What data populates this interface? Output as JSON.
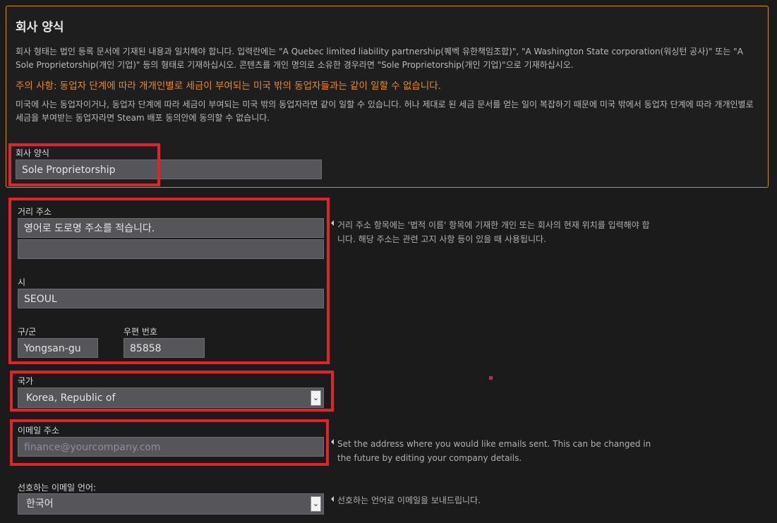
{
  "section": {
    "title": "회사 양식",
    "description_1": "회사 형태는 법인 등록 문서에 기재된 내용과 일치해야 합니다. 입력란에는 \"A Quebec limited liability partnership(퀘벡 유한책임조합)\", \"A Washington State corporation(워싱턴 공사)\" 또는 \"A Sole Proprietorship(개인 기업)\" 등의 형태로 기재하십시오. 콘텐츠를 개인 명의로 소유한 경우라면 \"Sole Proprietorship(개인 기업)\"으로 기재하십시오.",
    "warning": "주의 사항: 동업자 단계에 따라 개개인별로 세금이 부여되는 미국 밖의 동업자들과는 같이 일할 수 없습니다.",
    "description_2": "미국에 사는 동업자이거나, 동업자 단계에 따라 세금이 부여되는 미국 밖의 동업자라면 같이 일할 수 있습니다. 허나 제대로 된 세금 문서를 얻는 일이 복잡하기 때문에 미국 밖에서 동업자 단계에 따라 개개인별로 세금을 부여받는 동업자라면 Steam 배포 동의안에 동의할 수 없습니다.",
    "company_form_label": "회사 양식",
    "company_form_value": "Sole Proprietorship"
  },
  "address": {
    "street_label": "거리 주소",
    "street_line1": "영어로 도로명 주소를 적습니다.",
    "street_line2": "",
    "city_label": "시",
    "city_value": "SEOUL",
    "district_label": "구/군",
    "district_value": "Yongsan-gu",
    "postal_label": "우편 번호",
    "postal_value": "85858",
    "hint": "거리 주소 항목에는 '법적 이름' 항목에 기재한 개인 또는 회사의 현재 위치를 입력해야 합니다. 해당 주소는 관련 고지 사항 등이 있을 때 사용됩니다."
  },
  "country": {
    "label": "국가",
    "selected": "Korea, Republic of"
  },
  "email": {
    "label": "이메일 주소",
    "placeholder": "finance@yourcompany.com",
    "hint": "Set the address where you would like emails sent. This can be changed in the future by editing your company details."
  },
  "language": {
    "label": "선호하는 이메일 언어:",
    "selected": "한국어",
    "hint": "선호하는 언어로 이메일을 보내드립니다."
  },
  "colors": {
    "accent_border": "#c8912e",
    "warning_text": "#e8892b",
    "highlight_red": "#e3222b"
  },
  "icons": {
    "dropdown": "chevron-down-icon",
    "hint_pointer": "triangle-left-icon"
  }
}
